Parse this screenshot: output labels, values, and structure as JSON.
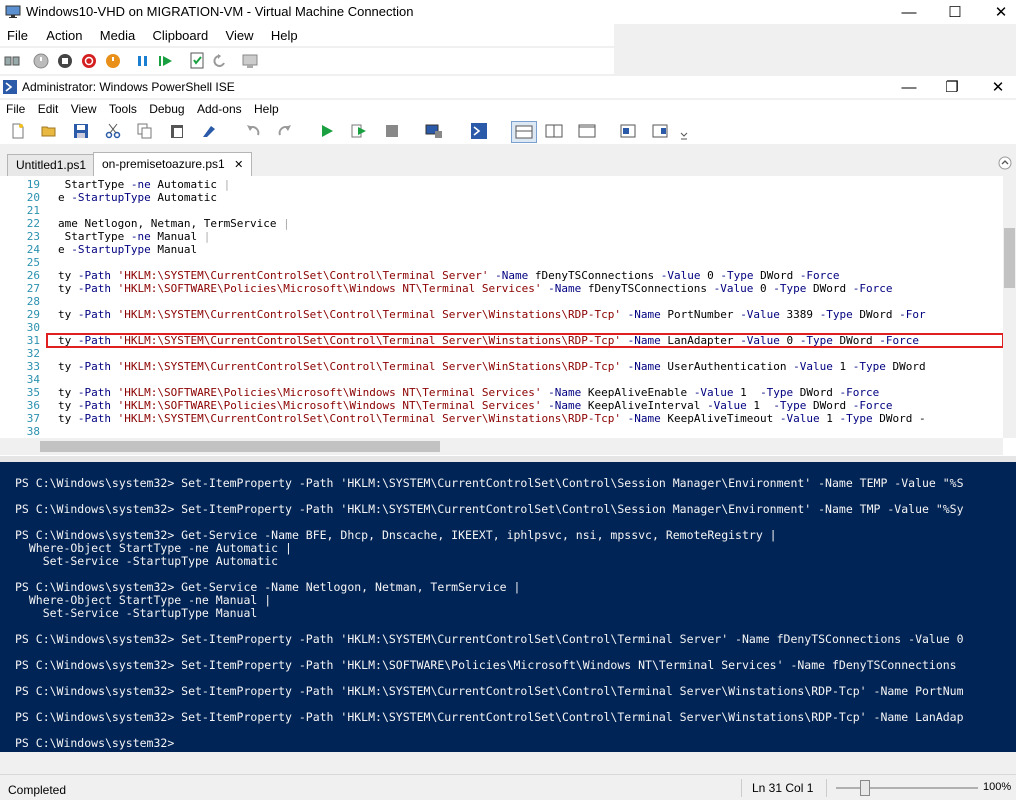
{
  "vm_window": {
    "title": "Windows10-VHD on MIGRATION-VM - Virtual Machine Connection",
    "menu": [
      "File",
      "Action",
      "Media",
      "Clipboard",
      "View",
      "Help"
    ],
    "controls": {
      "minimize": "—",
      "maximize": "☐",
      "close": "✕"
    }
  },
  "ise_window": {
    "title": "Administrator: Windows PowerShell ISE",
    "menu": [
      "File",
      "Edit",
      "View",
      "Tools",
      "Debug",
      "Add-ons",
      "Help"
    ],
    "controls": {
      "minimize": "—",
      "restore": "❐",
      "close": "✕"
    }
  },
  "tabs": [
    {
      "label": "Untitled1.ps1",
      "active": false
    },
    {
      "label": "on-premisetoazure.ps1",
      "active": true,
      "close_glyph": "✕"
    }
  ],
  "editor": {
    "lines": [
      {
        "n": "19",
        "text": " StartType -ne Automatic |"
      },
      {
        "n": "20",
        "text": "e -StartupType Automatic"
      },
      {
        "n": "21",
        "text": ""
      },
      {
        "n": "22",
        "text": "ame Netlogon, Netman, TermService |"
      },
      {
        "n": "23",
        "text": " StartType -ne Manual |"
      },
      {
        "n": "24",
        "text": "e -StartupType Manual"
      },
      {
        "n": "25",
        "text": ""
      },
      {
        "n": "26",
        "text": "ty -Path 'HKLM:\\SYSTEM\\CurrentControlSet\\Control\\Terminal Server' -Name fDenyTSConnections -Value 0 -Type DWord -Force"
      },
      {
        "n": "27",
        "text": "ty -Path 'HKLM:\\SOFTWARE\\Policies\\Microsoft\\Windows NT\\Terminal Services' -Name fDenyTSConnections -Value 0 -Type DWord -Force"
      },
      {
        "n": "28",
        "text": ""
      },
      {
        "n": "29",
        "text": "ty -Path 'HKLM:\\SYSTEM\\CurrentControlSet\\Control\\Terminal Server\\Winstations\\RDP-Tcp' -Name PortNumber -Value 3389 -Type DWord -For"
      },
      {
        "n": "30",
        "text": ""
      },
      {
        "n": "31",
        "text": "ty -Path 'HKLM:\\SYSTEM\\CurrentControlSet\\Control\\Terminal Server\\Winstations\\RDP-Tcp' -Name LanAdapter -Value 0 -Type DWord -Force"
      },
      {
        "n": "32",
        "text": ""
      },
      {
        "n": "33",
        "text": "ty -Path 'HKLM:\\SYSTEM\\CurrentControlSet\\Control\\Terminal Server\\WinStations\\RDP-Tcp' -Name UserAuthentication -Value 1 -Type DWord"
      },
      {
        "n": "34",
        "text": ""
      },
      {
        "n": "35",
        "text": "ty -Path 'HKLM:\\SOFTWARE\\Policies\\Microsoft\\Windows NT\\Terminal Services' -Name KeepAliveEnable -Value 1  -Type DWord -Force"
      },
      {
        "n": "36",
        "text": "ty -Path 'HKLM:\\SOFTWARE\\Policies\\Microsoft\\Windows NT\\Terminal Services' -Name KeepAliveInterval -Value 1  -Type DWord -Force"
      },
      {
        "n": "37",
        "text": "ty -Path 'HKLM:\\SYSTEM\\CurrentControlSet\\Control\\Terminal Server\\Winstations\\RDP-Tcp' -Name KeepAliveTimeout -Value 1 -Type DWord -"
      },
      {
        "n": "38",
        "text": ""
      }
    ],
    "highlighted_line": "31"
  },
  "console": {
    "lines": [
      "PS C:\\Windows\\system32> Set-ItemProperty -Path 'HKLM:\\SYSTEM\\CurrentControlSet\\Control\\Session Manager\\Environment' -Name TEMP -Value \"%S",
      "",
      "PS C:\\Windows\\system32> Set-ItemProperty -Path 'HKLM:\\SYSTEM\\CurrentControlSet\\Control\\Session Manager\\Environment' -Name TMP -Value \"%Sy",
      "",
      "PS C:\\Windows\\system32> Get-Service -Name BFE, Dhcp, Dnscache, IKEEXT, iphlpsvc, nsi, mpssvc, RemoteRegistry |",
      "  Where-Object StartType -ne Automatic |",
      "    Set-Service -StartupType Automatic",
      "",
      "PS C:\\Windows\\system32> Get-Service -Name Netlogon, Netman, TermService |",
      "  Where-Object StartType -ne Manual |",
      "    Set-Service -StartupType Manual",
      "",
      "PS C:\\Windows\\system32> Set-ItemProperty -Path 'HKLM:\\SYSTEM\\CurrentControlSet\\Control\\Terminal Server' -Name fDenyTSConnections -Value 0",
      "",
      "PS C:\\Windows\\system32> Set-ItemProperty -Path 'HKLM:\\SOFTWARE\\Policies\\Microsoft\\Windows NT\\Terminal Services' -Name fDenyTSConnections",
      "",
      "PS C:\\Windows\\system32> Set-ItemProperty -Path 'HKLM:\\SYSTEM\\CurrentControlSet\\Control\\Terminal Server\\Winstations\\RDP-Tcp' -Name PortNum",
      "",
      "PS C:\\Windows\\system32> Set-ItemProperty -Path 'HKLM:\\SYSTEM\\CurrentControlSet\\Control\\Terminal Server\\Winstations\\RDP-Tcp' -Name LanAdap",
      "",
      "PS C:\\Windows\\system32>"
    ]
  },
  "status": {
    "text": "Completed",
    "position": "Ln 31  Col 1",
    "zoom": "100%",
    "zoom_level": 0.2
  },
  "colors": {
    "console_bg": "#012456",
    "highlight_border": "#e02020",
    "line_number": "#2b91af"
  }
}
